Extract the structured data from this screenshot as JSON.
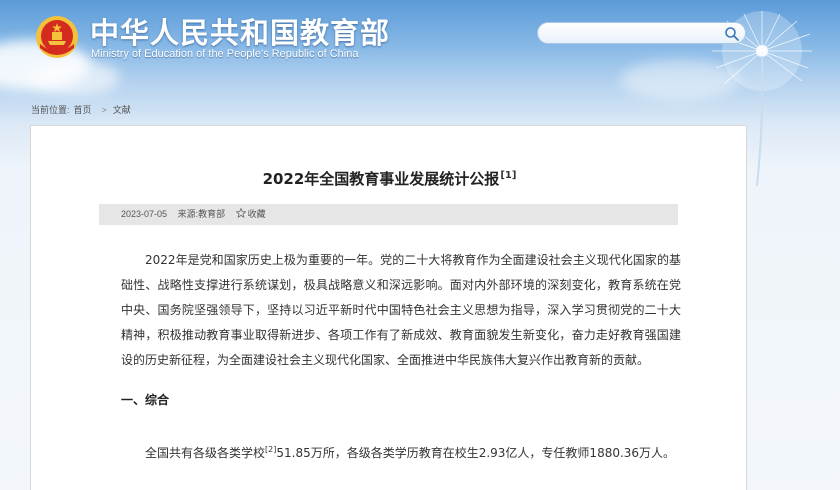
{
  "header": {
    "site_title": "中华人民共和国教育部",
    "site_subtitle": "Ministry of Education of the People's Republic of China",
    "emblem_icon": "national-emblem-icon"
  },
  "search": {
    "placeholder": "",
    "icon": "search-icon"
  },
  "breadcrumb": {
    "label": "当前位置:",
    "home": "首页",
    "separator": ">",
    "current": "文献"
  },
  "article": {
    "title": "2022年全国教育事业发展统计公报",
    "title_ref": "[1]",
    "date": "2023-07-05",
    "source": "来源:教育部",
    "favorite_label": "收藏",
    "paragraph1": "2022年是党和国家历史上极为重要的一年。党的二十大将教育作为全面建设社会主义现代化国家的基础性、战略性支撑进行系统谋划，极具战略意义和深远影响。面对内外部环境的深刻变化，教育系统在党中央、国务院坚强领导下，坚持以习近平新时代中国特色社会主义思想为指导，深入学习贯彻党的二十大精神，积极推动教育事业取得新进步、各项工作有了新成效、教育面貌发生新变化，奋力走好教育强国建设的历史新征程，为全面建设社会主义现代化国家、全面推进中华民族伟大复兴作出教育新的贡献。",
    "section1_title": "一、综合",
    "paragraph2_a": "全国共有各级各类学校",
    "paragraph2_ref": "[2]",
    "paragraph2_b": "51.85万所，各级各类学历教育在校生2.93亿人，专任教师1880.36万人。"
  },
  "colors": {
    "sky_top": "#5b9bd8",
    "meta_bar": "#e6e6e6",
    "emblem_red": "#d52b1e",
    "emblem_gold": "#f3c13a"
  }
}
